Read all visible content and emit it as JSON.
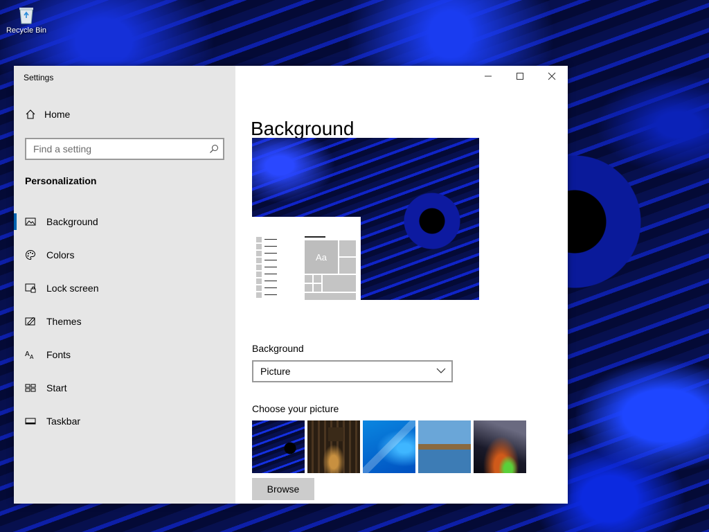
{
  "desktop": {
    "recycle_bin_label": "Recycle Bin"
  },
  "window": {
    "app_title": "Settings",
    "controls": [
      "minimize-icon",
      "maximize-icon",
      "close-icon"
    ]
  },
  "nav": {
    "home_label": "Home",
    "search_placeholder": "Find a setting",
    "section_title": "Personalization",
    "items": [
      {
        "label": "Background",
        "icon": "picture-icon",
        "active": true
      },
      {
        "label": "Colors",
        "icon": "palette-icon",
        "active": false
      },
      {
        "label": "Lock screen",
        "icon": "lock-screen-icon",
        "active": false
      },
      {
        "label": "Themes",
        "icon": "themes-icon",
        "active": false
      },
      {
        "label": "Fonts",
        "icon": "fonts-icon",
        "active": false
      },
      {
        "label": "Start",
        "icon": "start-icon",
        "active": false
      },
      {
        "label": "Taskbar",
        "icon": "taskbar-icon",
        "active": false
      }
    ]
  },
  "content": {
    "title": "Background",
    "preview_tile_text": "Aa",
    "background_label": "Background",
    "background_value": "Picture",
    "choose_label": "Choose your picture",
    "browse_label": "Browse"
  },
  "colors": {
    "accent": "#0063b1",
    "nav_bg": "#e6e6e6"
  }
}
